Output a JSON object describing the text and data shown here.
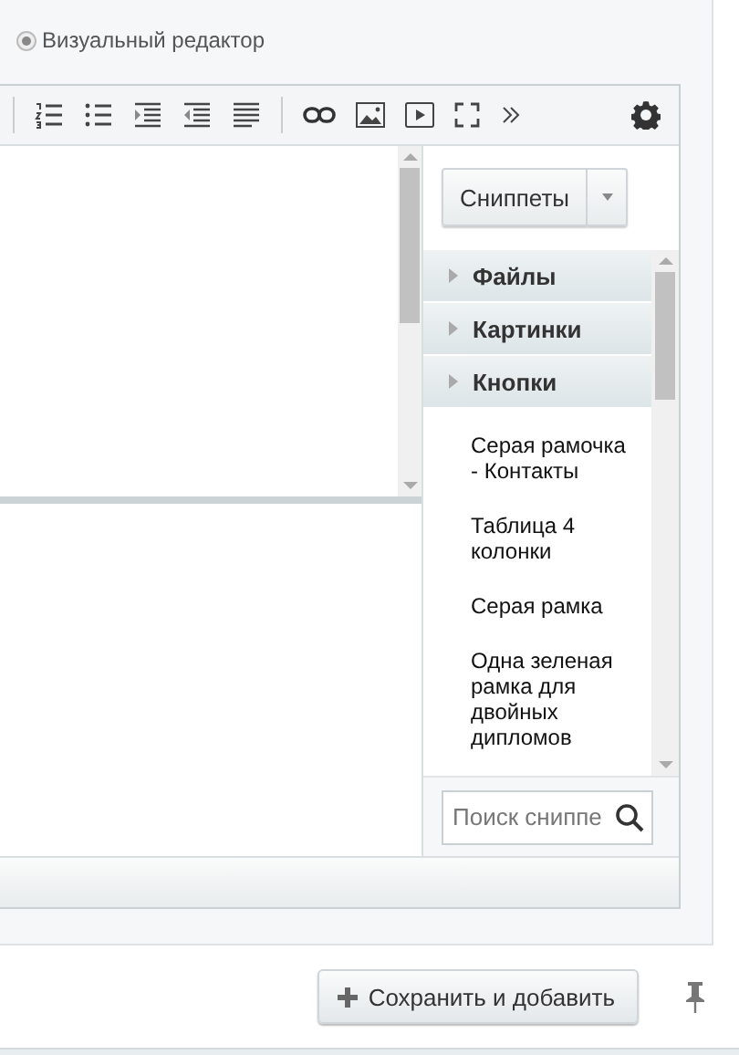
{
  "editor_mode": {
    "label": "Визуальный редактор",
    "selected": true
  },
  "snippets_button": {
    "label": "Сниппеты"
  },
  "categories": [
    {
      "label": "Файлы",
      "expanded": false
    },
    {
      "label": "Картинки",
      "expanded": false
    },
    {
      "label": "Кнопки",
      "expanded": false
    }
  ],
  "snippets": [
    "Серая рамочка - Контакты",
    "Таблица 4 колонки",
    "Серая рамка",
    "Одна зеленая рамка для двойных дипломов"
  ],
  "search": {
    "placeholder": "Поиск сниппе"
  },
  "save_button": {
    "label": "Сохранить и добавить"
  }
}
